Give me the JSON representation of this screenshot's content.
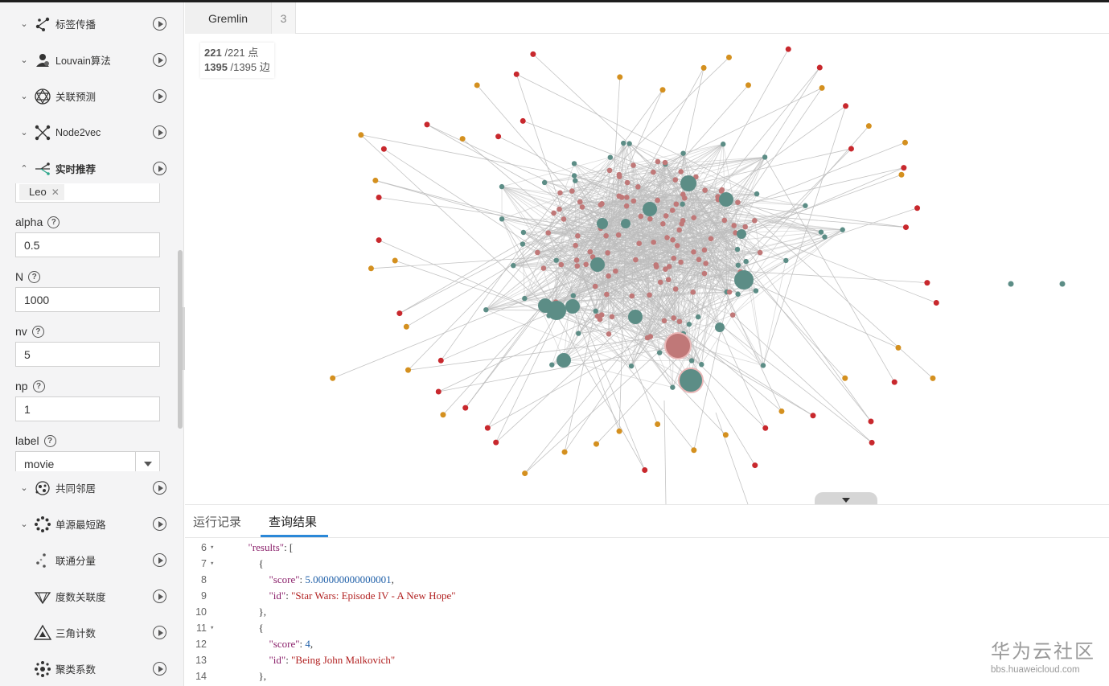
{
  "sidebar": {
    "algorithms_top": [
      {
        "label": "标签传播",
        "icon": "label-propagation-icon",
        "expanded": false
      },
      {
        "label": "Louvain算法",
        "icon": "user-icon",
        "expanded": false
      },
      {
        "label": "关联预测",
        "icon": "link-prediction-icon",
        "expanded": false
      },
      {
        "label": "Node2vec",
        "icon": "node2vec-icon",
        "expanded": false
      },
      {
        "label": "实时推荐",
        "icon": "realtime-recommend-icon",
        "expanded": true
      }
    ],
    "params": {
      "tag_value": "Leo",
      "alpha_label": "alpha",
      "alpha_value": "0.5",
      "n_label": "N",
      "n_value": "1000",
      "nv_label": "nv",
      "nv_value": "5",
      "np_label": "np",
      "np_value": "1",
      "label_label": "label",
      "label_value": "movie",
      "help_glyph": "?"
    },
    "algorithms_bottom": [
      {
        "label": "共同邻居",
        "icon": "common-neighbors-icon"
      },
      {
        "label": "单源最短路",
        "icon": "shortest-path-icon"
      },
      {
        "label": "联通分量",
        "icon": "connected-components-icon"
      },
      {
        "label": "度数关联度",
        "icon": "degree-correlation-icon"
      },
      {
        "label": "三角计数",
        "icon": "triangle-count-icon"
      },
      {
        "label": "聚类系数",
        "icon": "clustering-coefficient-icon"
      }
    ]
  },
  "tabs": [
    {
      "label": "Gremlin"
    },
    {
      "label": "3"
    }
  ],
  "graph": {
    "vertex_shown": "221",
    "vertex_total": "/221 点",
    "edge_shown": "1395",
    "edge_total": "/1395 边",
    "colors": {
      "orange": "#d4901f",
      "red": "#c8282d",
      "pink": "#c07878",
      "teal": "#5c8d86",
      "edge": "#bdbdbd"
    }
  },
  "bottom_panel": {
    "tabs": [
      {
        "label": "运行记录"
      },
      {
        "label": "查询结果"
      }
    ],
    "active_tab": "查询结果",
    "lines": [
      {
        "n": "6",
        "fold": "▾",
        "text": "  \"results\": ["
      },
      {
        "n": "7",
        "fold": "▾",
        "text": "      {"
      },
      {
        "n": "8",
        "fold": "",
        "text": "          \"score\": 5.000000000000001,"
      },
      {
        "n": "9",
        "fold": "",
        "text": "          \"id\": \"Star Wars: Episode IV - A New Hope\""
      },
      {
        "n": "10",
        "fold": "",
        "text": "      },"
      },
      {
        "n": "11",
        "fold": "▾",
        "text": "      {"
      },
      {
        "n": "12",
        "fold": "",
        "text": "          \"score\": 4,"
      },
      {
        "n": "13",
        "fold": "",
        "text": "          \"id\": \"Being John Malkovich\""
      },
      {
        "n": "14",
        "fold": "",
        "text": "      },"
      }
    ]
  },
  "watermark": {
    "title": "华为云社区",
    "url": "bbs.huaweicloud.com"
  }
}
